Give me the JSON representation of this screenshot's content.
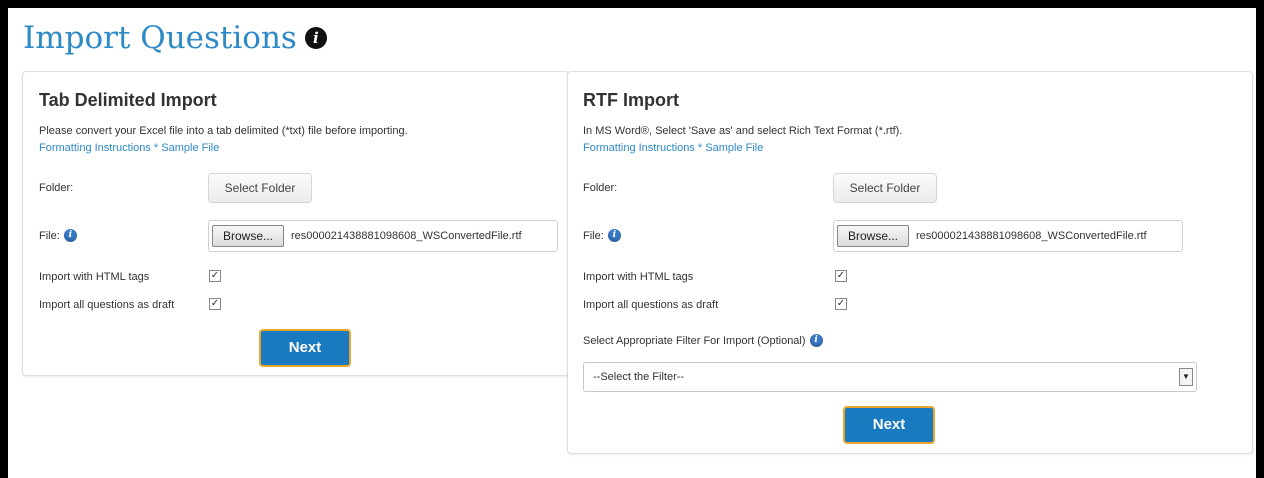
{
  "page": {
    "title": "Import Questions",
    "title_color": "#2d8ac7",
    "info_icon": "info-icon"
  },
  "tab_import": {
    "heading": "Tab Delimited Import",
    "description": "Please convert your Excel file into a tab delimited (*txt) file before importing.",
    "link_formatting": "Formatting Instructions",
    "link_separator": " * ",
    "link_sample": "Sample File",
    "folder_label": "Folder:",
    "select_folder_button": "Select Folder",
    "file_label": "File:",
    "browse_button": "Browse...",
    "file_name": "res000021438881098608_WSConvertedFile.rtf",
    "html_tags_label": "Import with HTML tags",
    "html_tags_checked": true,
    "draft_label": "Import all questions as draft",
    "draft_checked": true,
    "next_button": "Next"
  },
  "rtf_import": {
    "heading": "RTF Import",
    "description": "In MS Word®, Select 'Save as' and select Rich Text Format (*.rtf).",
    "link_formatting": "Formatting Instructions",
    "link_separator": " * ",
    "link_sample": "Sample File",
    "folder_label": "Folder:",
    "select_folder_button": "Select Folder",
    "file_label": "File:",
    "browse_button": "Browse...",
    "file_name": "res000021438881098608_WSConvertedFile.rtf",
    "html_tags_label": "Import with HTML tags",
    "html_tags_checked": true,
    "draft_label": "Import all questions as draft",
    "draft_checked": true,
    "filter_label": "Select Appropriate Filter For Import (Optional)",
    "filter_selected": "--Select the Filter--",
    "next_button": "Next"
  },
  "colors": {
    "link": "#2d8ac7",
    "next_button_bg": "#1a7ac0",
    "next_button_border": "#e8a72c"
  }
}
